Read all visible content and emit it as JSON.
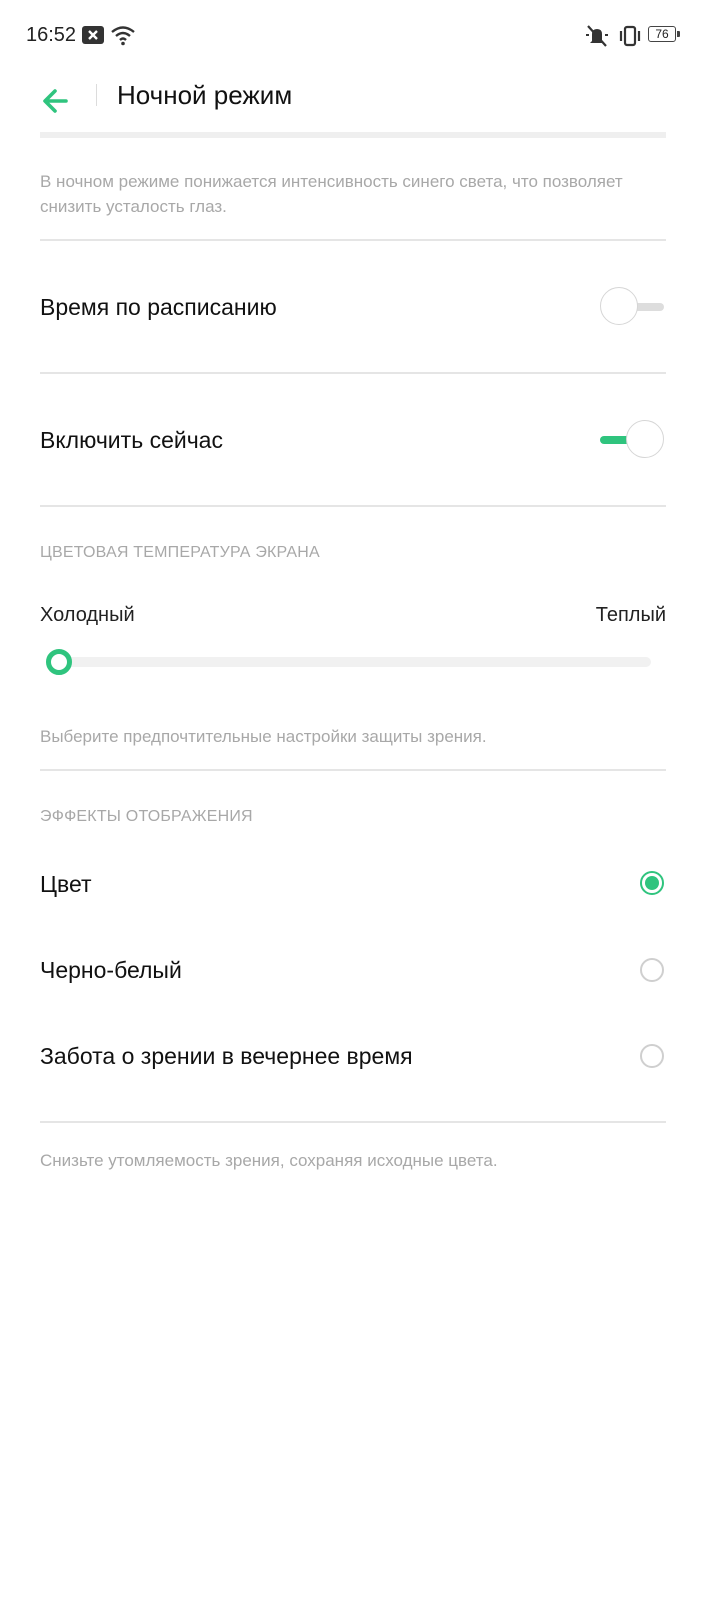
{
  "status_bar": {
    "time": "16:52",
    "battery": "76",
    "icons": [
      "notification-x-icon",
      "wifi-icon",
      "mute-icon",
      "vibrate-icon",
      "battery-icon"
    ]
  },
  "header": {
    "title": "Ночной режим",
    "back_icon": "arrow-left-icon"
  },
  "intro_text": "В ночном режиме понижается интенсивность синего света, что позволяет снизить усталость глаз.",
  "settings": [
    {
      "label": "Время по расписанию",
      "enabled": false
    },
    {
      "label": "Включить сейчас",
      "enabled": true
    }
  ],
  "color_temperature": {
    "section_title": "ЦВЕТОВАЯ ТЕМПЕРАТУРА ЭКРАНА",
    "min_label": "Холодный",
    "max_label": "Теплый",
    "value_percent": 0,
    "hint": "Выберите предпочтительные настройки защиты зрения."
  },
  "display_effects": {
    "section_title": "ЭФФЕКТЫ ОТОБРАЖЕНИЯ",
    "options": [
      {
        "label": "Цвет",
        "selected": true
      },
      {
        "label": "Черно-белый",
        "selected": false
      },
      {
        "label": "Забота о зрении в вечернее время",
        "selected": false
      }
    ],
    "hint": "Снизьте утомляемость зрения, сохраняя исходные цвета."
  },
  "colors": {
    "accent": "#2fc47e",
    "secondary_text": "#a8a8a8",
    "divider": "#e5e5e5"
  }
}
